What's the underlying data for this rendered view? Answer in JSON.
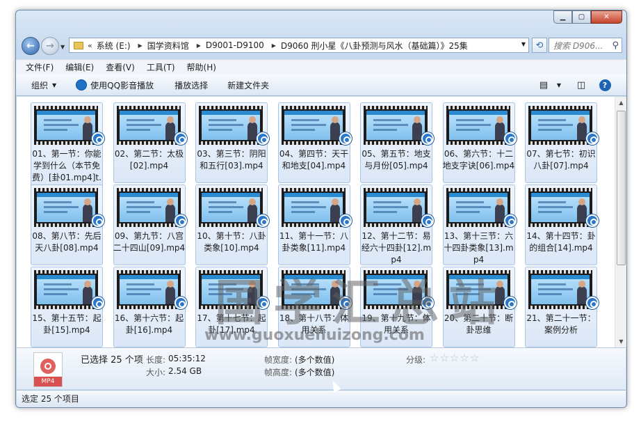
{
  "address": {
    "crumbs": [
      "系统 (E:)",
      "国学资料馆",
      "D9001-D9100",
      "D9060 刑小星《八卦预测与风水（基础篇）》25集"
    ]
  },
  "search": {
    "placeholder": "搜索 D906..."
  },
  "menu": [
    "文件(F)",
    "编辑(E)",
    "查看(V)",
    "工具(T)",
    "帮助(H)"
  ],
  "toolbar": {
    "organize": "组织",
    "play_qq": "使用QQ影音播放",
    "play_selected": "播放选择",
    "new_folder": "新建文件夹"
  },
  "files": [
    "01、第一节：你能学到什么（本节免费）[卦01.mp4]t.mp4",
    "02、第二节：太极[02].mp4",
    "03、第三节：阴阳和五行[03].mp4",
    "04、第四节：天干和地支[04].mp4",
    "05、第五节：地支与月份[05].mp4",
    "06、第六节：十二地支字诀[06].mp4",
    "07、第七节：初识八卦[07].mp4",
    "08、第八节：先后天八卦[08].mp4",
    "09、第九节：八宫二十四山[09].mp4",
    "10、第十节：八卦类象[10].mp4",
    "11、第十一节：八卦类象[11].mp4",
    "12、第十二节：易经六十四卦[12].mp4",
    "13、第十三节：六十四卦类象[13].mp4",
    "14、第十四节：卦的组合[14].mp4",
    "15、第十五节：起卦[15].mp4",
    "16、第十六节：起卦[16].mp4",
    "17、第十七节：起卦[17].mp4",
    "18、第十八节：体用关系",
    "19、第十九节：体用关系",
    "20、第二十节：断卦思维",
    "21、第二十一节：案例分析"
  ],
  "watermark": {
    "title": "国学汇总站",
    "url": "www.guoxuehuizong.com"
  },
  "details": {
    "selected": "已选择 25 个项",
    "length_label": "长度:",
    "length": "05:35:12",
    "size_label": "大小:",
    "size": "2.54 GB",
    "frame_width_label": "帧宽度:",
    "frame_width": "(多个数值)",
    "frame_height_label": "帧高度:",
    "frame_height": "(多个数值)",
    "rating_label": "分级:",
    "icon_text": "MP4"
  },
  "status": "选定 25 个项目"
}
